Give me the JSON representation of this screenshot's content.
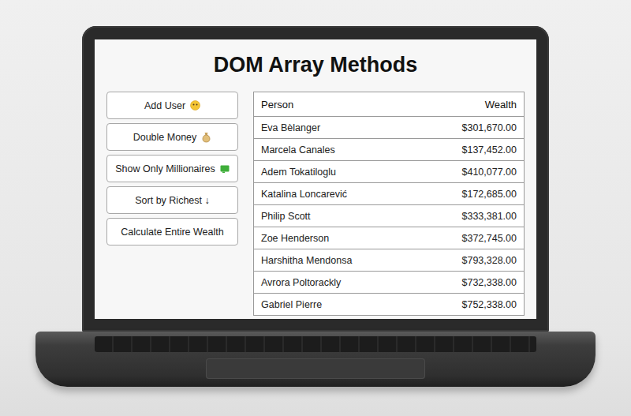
{
  "title": "DOM Array Methods",
  "buttons": [
    {
      "label": "Add User",
      "kind": "face"
    },
    {
      "label": "Double Money",
      "kind": "bag"
    },
    {
      "label": "Show Only Millionaires",
      "kind": "bill"
    },
    {
      "label": "Sort by Richest ↓",
      "kind": "plain"
    },
    {
      "label": "Calculate Entire Wealth",
      "kind": "plain"
    }
  ],
  "table": {
    "columns": [
      "Person",
      "Wealth"
    ],
    "rows": [
      {
        "person": "Eva Bèlanger",
        "wealth": "$301,670.00"
      },
      {
        "person": "Marcela Canales",
        "wealth": "$137,452.00"
      },
      {
        "person": "Adem Tokatiloglu",
        "wealth": "$410,077.00"
      },
      {
        "person": "Katalina Loncarević",
        "wealth": "$172,685.00"
      },
      {
        "person": "Philip Scott",
        "wealth": "$333,381.00"
      },
      {
        "person": "Zoe Henderson",
        "wealth": "$372,745.00"
      },
      {
        "person": "Harshitha Mendonsa",
        "wealth": "$793,328.00"
      },
      {
        "person": "Avrora Poltorackly",
        "wealth": "$732,338.00"
      },
      {
        "person": "Gabriel Pierre",
        "wealth": "$752,338.00"
      }
    ]
  }
}
